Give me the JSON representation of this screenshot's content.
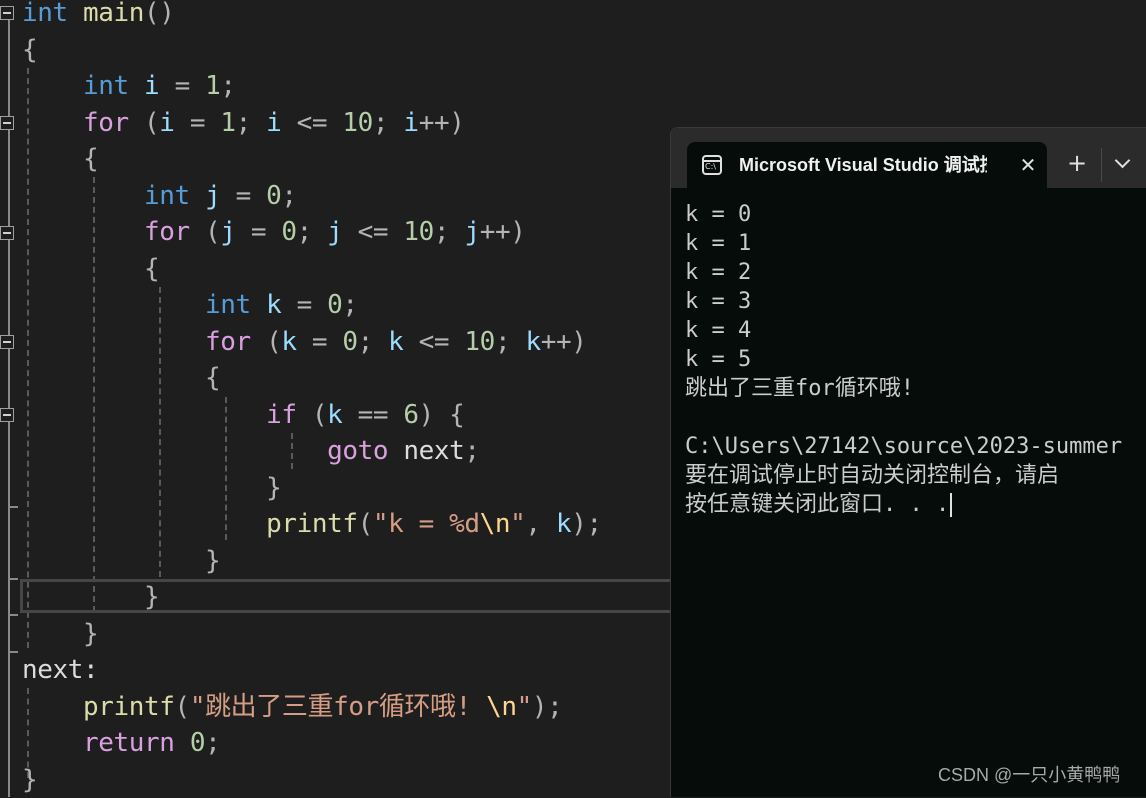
{
  "editor": {
    "lines": [
      [
        {
          "c": "kw-type",
          "t": "int"
        },
        {
          "c": "plain",
          "t": " "
        },
        {
          "c": "fn",
          "t": "main"
        },
        {
          "c": "punc",
          "t": "()"
        }
      ],
      [
        {
          "c": "punc",
          "t": "{"
        }
      ],
      [
        {
          "c": "plain",
          "t": "    "
        },
        {
          "c": "kw-type",
          "t": "int"
        },
        {
          "c": "plain",
          "t": " "
        },
        {
          "c": "var",
          "t": "i"
        },
        {
          "c": "punc",
          "t": " = "
        },
        {
          "c": "num",
          "t": "1"
        },
        {
          "c": "punc",
          "t": ";"
        }
      ],
      [
        {
          "c": "plain",
          "t": "    "
        },
        {
          "c": "kw-ctrl",
          "t": "for"
        },
        {
          "c": "punc",
          "t": " ("
        },
        {
          "c": "var",
          "t": "i"
        },
        {
          "c": "punc",
          "t": " = "
        },
        {
          "c": "num",
          "t": "1"
        },
        {
          "c": "punc",
          "t": "; "
        },
        {
          "c": "var",
          "t": "i"
        },
        {
          "c": "punc",
          "t": " <= "
        },
        {
          "c": "num",
          "t": "10"
        },
        {
          "c": "punc",
          "t": "; "
        },
        {
          "c": "var",
          "t": "i"
        },
        {
          "c": "punc",
          "t": "++)"
        }
      ],
      [
        {
          "c": "plain",
          "t": "    "
        },
        {
          "c": "punc",
          "t": "{"
        }
      ],
      [
        {
          "c": "plain",
          "t": "        "
        },
        {
          "c": "kw-type",
          "t": "int"
        },
        {
          "c": "plain",
          "t": " "
        },
        {
          "c": "var",
          "t": "j"
        },
        {
          "c": "punc",
          "t": " = "
        },
        {
          "c": "num",
          "t": "0"
        },
        {
          "c": "punc",
          "t": ";"
        }
      ],
      [
        {
          "c": "plain",
          "t": "        "
        },
        {
          "c": "kw-ctrl",
          "t": "for"
        },
        {
          "c": "punc",
          "t": " ("
        },
        {
          "c": "var",
          "t": "j"
        },
        {
          "c": "punc",
          "t": " = "
        },
        {
          "c": "num",
          "t": "0"
        },
        {
          "c": "punc",
          "t": "; "
        },
        {
          "c": "var",
          "t": "j"
        },
        {
          "c": "punc",
          "t": " <= "
        },
        {
          "c": "num",
          "t": "10"
        },
        {
          "c": "punc",
          "t": "; "
        },
        {
          "c": "var",
          "t": "j"
        },
        {
          "c": "punc",
          "t": "++)"
        }
      ],
      [
        {
          "c": "plain",
          "t": "        "
        },
        {
          "c": "punc",
          "t": "{"
        }
      ],
      [
        {
          "c": "plain",
          "t": "            "
        },
        {
          "c": "kw-type",
          "t": "int"
        },
        {
          "c": "plain",
          "t": " "
        },
        {
          "c": "var",
          "t": "k"
        },
        {
          "c": "punc",
          "t": " = "
        },
        {
          "c": "num",
          "t": "0"
        },
        {
          "c": "punc",
          "t": ";"
        }
      ],
      [
        {
          "c": "plain",
          "t": "            "
        },
        {
          "c": "kw-ctrl",
          "t": "for"
        },
        {
          "c": "punc",
          "t": " ("
        },
        {
          "c": "var",
          "t": "k"
        },
        {
          "c": "punc",
          "t": " = "
        },
        {
          "c": "num",
          "t": "0"
        },
        {
          "c": "punc",
          "t": "; "
        },
        {
          "c": "var",
          "t": "k"
        },
        {
          "c": "punc",
          "t": " <= "
        },
        {
          "c": "num",
          "t": "10"
        },
        {
          "c": "punc",
          "t": "; "
        },
        {
          "c": "var",
          "t": "k"
        },
        {
          "c": "punc",
          "t": "++)"
        }
      ],
      [
        {
          "c": "plain",
          "t": "            "
        },
        {
          "c": "punc",
          "t": "{"
        }
      ],
      [
        {
          "c": "plain",
          "t": "                "
        },
        {
          "c": "kw-ctrl",
          "t": "if"
        },
        {
          "c": "punc",
          "t": " ("
        },
        {
          "c": "var",
          "t": "k"
        },
        {
          "c": "punc",
          "t": " == "
        },
        {
          "c": "num",
          "t": "6"
        },
        {
          "c": "punc",
          "t": ") {"
        }
      ],
      [
        {
          "c": "plain",
          "t": "                    "
        },
        {
          "c": "kw-ctrl",
          "t": "goto"
        },
        {
          "c": "plain",
          "t": " next"
        },
        {
          "c": "punc",
          "t": ";"
        }
      ],
      [
        {
          "c": "plain",
          "t": "                "
        },
        {
          "c": "punc",
          "t": "}"
        }
      ],
      [
        {
          "c": "plain",
          "t": "                "
        },
        {
          "c": "fn",
          "t": "printf"
        },
        {
          "c": "punc",
          "t": "("
        },
        {
          "c": "str",
          "t": "\"k = %d"
        },
        {
          "c": "esc",
          "t": "\\n"
        },
        {
          "c": "str",
          "t": "\""
        },
        {
          "c": "punc",
          "t": ", "
        },
        {
          "c": "var",
          "t": "k"
        },
        {
          "c": "punc",
          "t": ");"
        }
      ],
      [
        {
          "c": "plain",
          "t": "            "
        },
        {
          "c": "punc",
          "t": "}"
        }
      ],
      [
        {
          "c": "plain",
          "t": "        "
        },
        {
          "c": "punc",
          "t": "}"
        }
      ],
      [
        {
          "c": "plain",
          "t": "    "
        },
        {
          "c": "punc",
          "t": "}"
        }
      ],
      [
        {
          "c": "plain",
          "t": "next:"
        }
      ],
      [
        {
          "c": "plain",
          "t": "    "
        },
        {
          "c": "fn",
          "t": "printf"
        },
        {
          "c": "punc",
          "t": "("
        },
        {
          "c": "str",
          "t": "\"跳出了三重for循环哦! "
        },
        {
          "c": "esc",
          "t": "\\n"
        },
        {
          "c": "str",
          "t": "\""
        },
        {
          "c": "punc",
          "t": ");"
        }
      ],
      [
        {
          "c": "plain",
          "t": "    "
        },
        {
          "c": "kw-ctrl",
          "t": "return"
        },
        {
          "c": "plain",
          "t": " "
        },
        {
          "c": "num",
          "t": "0"
        },
        {
          "c": "punc",
          "t": ";"
        }
      ],
      [
        {
          "c": "punc",
          "t": "}"
        }
      ]
    ]
  },
  "terminal": {
    "tab_title": "Microsoft Visual Studio 调试控制台",
    "tab_icon": "console-icon",
    "icon_text": "C:\\",
    "close_glyph": "✕",
    "new_tab_glyph": "+",
    "output": [
      "k = 0",
      "k = 1",
      "k = 2",
      "k = 3",
      "k = 4",
      "k = 5",
      "跳出了三重for循环哦!",
      "",
      "C:\\Users\\27142\\source\\2023-summer",
      "要在调试停止时自动关闭控制台，请启",
      "按任意键关闭此窗口. . ."
    ]
  },
  "watermark": "CSDN @一只小黄鸭鸭"
}
